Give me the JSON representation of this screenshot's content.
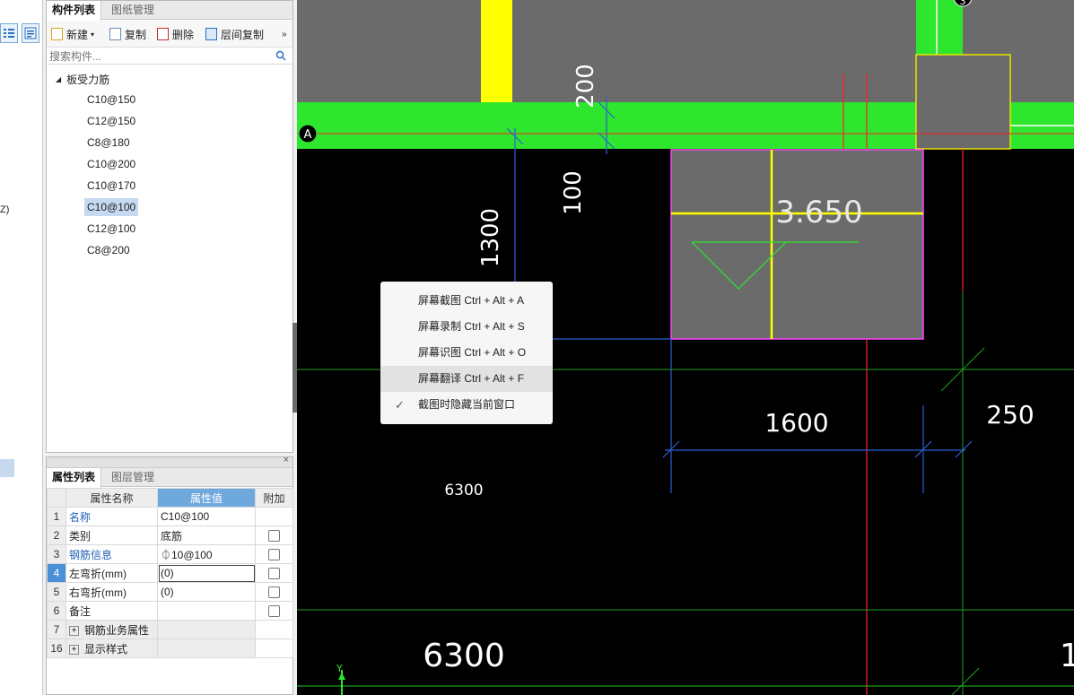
{
  "left_strip": {
    "partial_text": "Z)"
  },
  "component_panel": {
    "tabs": [
      {
        "label": "构件列表"
      },
      {
        "label": "图纸管理"
      }
    ],
    "toolbar": {
      "new_label": "新建",
      "copy_label": "复制",
      "delete_label": "删除",
      "floor_copy_label": "层间复制",
      "more_label": "»"
    },
    "search": {
      "placeholder": "搜索构件..."
    },
    "tree": {
      "root_label": "板受力筋",
      "items": [
        {
          "label": "C10@150"
        },
        {
          "label": "C12@150"
        },
        {
          "label": "C8@180"
        },
        {
          "label": "C10@200"
        },
        {
          "label": "C10@170"
        },
        {
          "label": "C10@100",
          "selected": true
        },
        {
          "label": "C12@100"
        },
        {
          "label": "C8@200"
        }
      ]
    }
  },
  "property_panel": {
    "close_label": "×",
    "tabs": [
      {
        "label": "属性列表"
      },
      {
        "label": "图层管理"
      }
    ],
    "headers": {
      "name": "属性名称",
      "value": "属性值",
      "extra": "附加"
    },
    "rows": [
      {
        "num": "1",
        "name": "名称",
        "value": "C10@100"
      },
      {
        "num": "2",
        "name": "类别",
        "value": "底筋"
      },
      {
        "num": "3",
        "name": "钢筋信息",
        "value": "⏀10@100"
      },
      {
        "num": "4",
        "name": "左弯折(mm)",
        "value": "(0)"
      },
      {
        "num": "5",
        "name": "右弯折(mm)",
        "value": "(0)"
      },
      {
        "num": "6",
        "name": "备注",
        "value": ""
      },
      {
        "num": "7",
        "name": "钢筋业务属性",
        "value": ""
      },
      {
        "num": "16",
        "name": "显示样式",
        "value": ""
      }
    ]
  },
  "canvas": {
    "axis_labels": {
      "a": "A",
      "three": "3",
      "y": "Y"
    },
    "dims": {
      "d200": "200",
      "d100": "100",
      "d1300": "1300",
      "elev": "3.650",
      "d1600": "1600",
      "d250": "250",
      "d6300_small": "6300",
      "d6300_big": "6300",
      "d1_partial": "1"
    },
    "colors": {
      "slab_green": "#2ee62e",
      "yellow": "#ffff00",
      "magenta": "#ff44ff",
      "red": "#ff2020",
      "blue": "#2a5fd8"
    }
  },
  "context_menu": {
    "items": [
      {
        "label": "屏幕截图 Ctrl + Alt + A"
      },
      {
        "label": "屏幕录制 Ctrl + Alt + S"
      },
      {
        "label": "屏幕识图 Ctrl + Alt + O"
      },
      {
        "label": "屏幕翻译 Ctrl + Alt + F"
      },
      {
        "label": "截图时隐藏当前窗口",
        "checked": true
      }
    ]
  }
}
